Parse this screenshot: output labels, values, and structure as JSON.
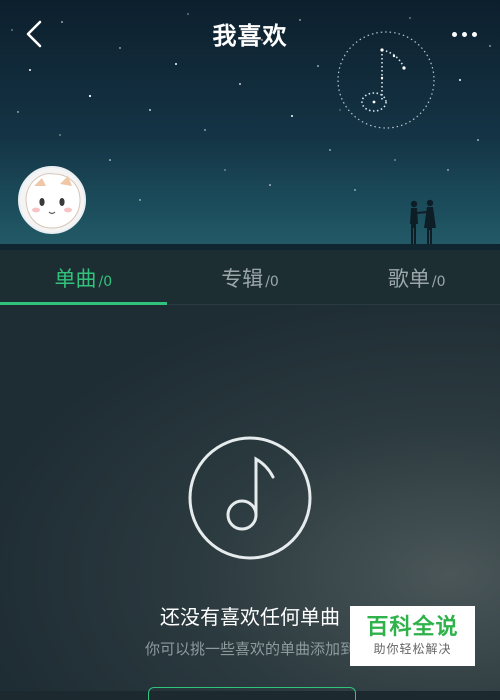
{
  "header": {
    "title": "我喜欢",
    "back_icon": "chevron-left-icon",
    "more_icon": "more-horizontal-icon"
  },
  "tabs": [
    {
      "label": "单曲",
      "count": "/0",
      "active": true
    },
    {
      "label": "专辑",
      "count": "/0",
      "active": false
    },
    {
      "label": "歌单",
      "count": "/0",
      "active": false
    }
  ],
  "empty_state": {
    "icon": "music-note-disc-icon",
    "title": "还没有喜欢任何单曲",
    "subtitle": "你可以挑一些喜欢的单曲添加到"
  },
  "watermark": {
    "main": "百科全说",
    "sub": "助你轻松解决"
  },
  "colors": {
    "accent": "#31c27c",
    "tab_inactive": "#9aa6aa",
    "watermark_green": "#2fb24a"
  }
}
